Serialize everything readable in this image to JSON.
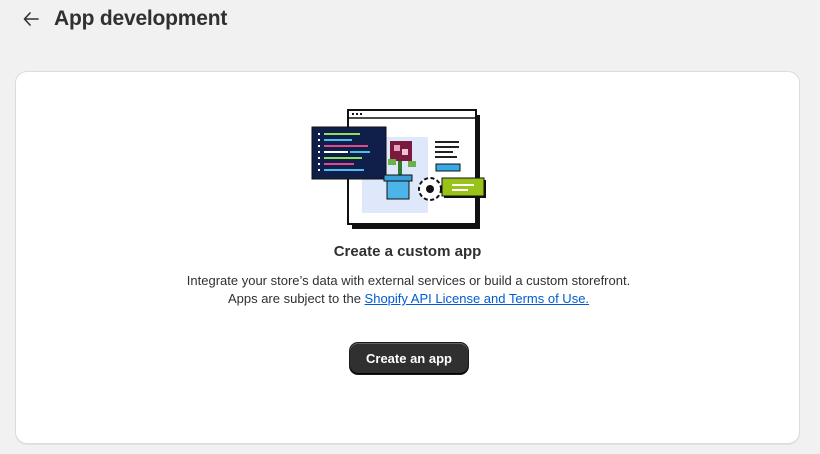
{
  "header": {
    "title": "App development",
    "back_icon": "arrow-left-icon"
  },
  "card": {
    "illustration_icon": "custom-app-illustration-icon",
    "title": "Create a custom app",
    "description_prefix": "Integrate your store’s data with external services or build a custom storefront. Apps are subject to the ",
    "link_text": "Shopify API License and Terms of Use.",
    "button_label": "Create an app"
  },
  "colors": {
    "background": "#f1f1f1",
    "card": "#ffffff",
    "text": "#303030",
    "link": "#005bd3",
    "button": "#303030"
  }
}
